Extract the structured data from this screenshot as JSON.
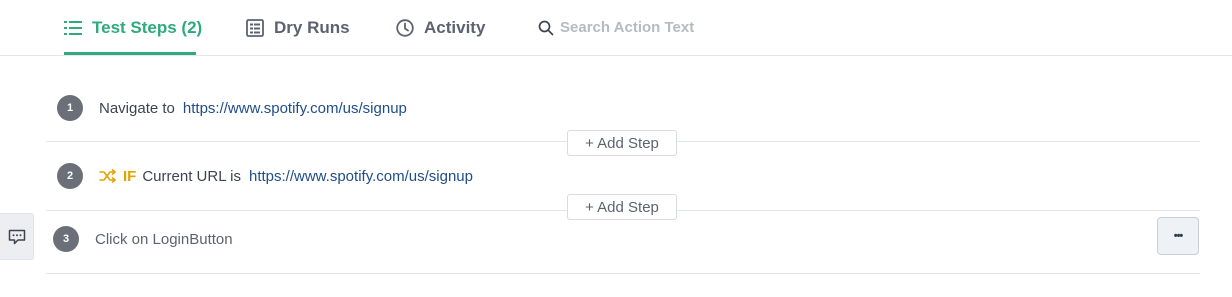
{
  "tabs": [
    {
      "label": "Test Steps (2)",
      "icon": "list-icon",
      "active": true
    },
    {
      "label": "Dry Runs",
      "icon": "dry-runs-icon",
      "active": false
    },
    {
      "label": "Activity",
      "icon": "clock-icon",
      "active": false
    }
  ],
  "search": {
    "placeholder": "Search Action Text",
    "value": ""
  },
  "steps": [
    {
      "number": "1",
      "text": "Navigate to",
      "url": "https://www.spotify.com/us/signup"
    },
    {
      "number": "2",
      "icon": "shuffle-icon",
      "condition": "IF",
      "text": "Current URL is",
      "url": "https://www.spotify.com/us/signup"
    },
    {
      "number": "3",
      "text": "Click on LoginButton"
    }
  ],
  "add_step_label": "+ Add Step",
  "more_label": "•••",
  "colors": {
    "accent": "#2eaa7b",
    "link": "#1f4d8a",
    "if": "#e0a400",
    "step_badge": "#6b6f78"
  }
}
